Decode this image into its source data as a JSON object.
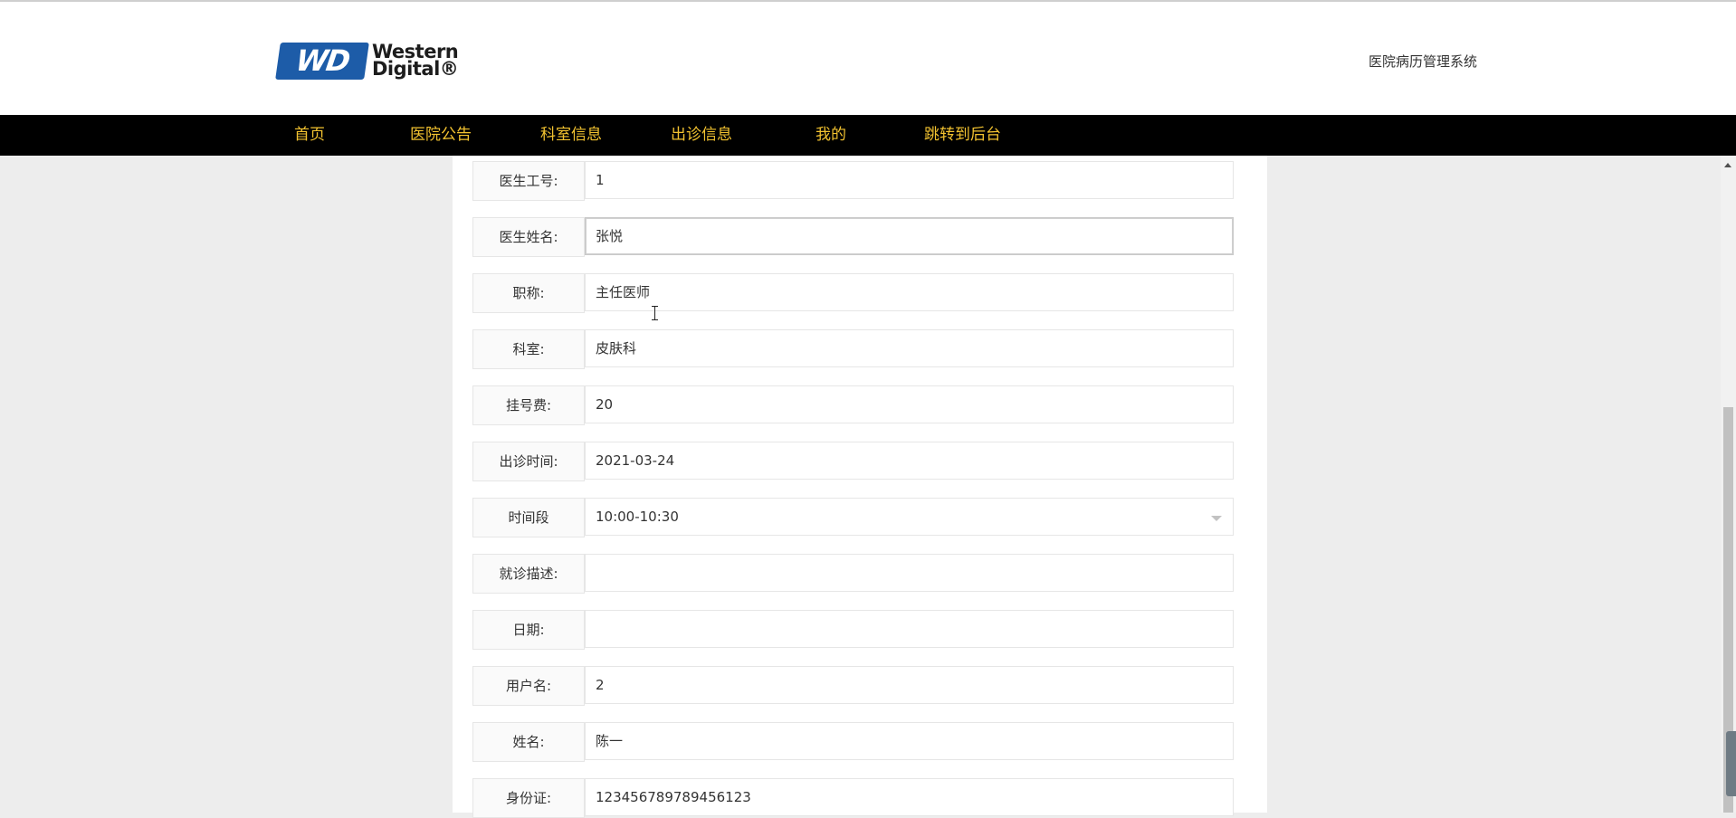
{
  "header": {
    "logo": {
      "badge": "WD",
      "line1": "Western",
      "line2": "Digital®"
    },
    "site_title": "医院病历管理系统"
  },
  "nav": {
    "items": [
      "首页",
      "医院公告",
      "科室信息",
      "出诊信息",
      "我的",
      "跳转到后台"
    ]
  },
  "form": {
    "fields": [
      {
        "label": "医生工号:",
        "value": "1"
      },
      {
        "label": "医生姓名:",
        "value": "张悦"
      },
      {
        "label": "职称:",
        "value": "主任医师"
      },
      {
        "label": "科室:",
        "value": "皮肤科"
      },
      {
        "label": "挂号费:",
        "value": "20"
      },
      {
        "label": "出诊时间:",
        "value": "2021-03-24"
      },
      {
        "label": "时间段",
        "value": "10:00-10:30"
      },
      {
        "label": "就诊描述:",
        "value": ""
      },
      {
        "label": "日期:",
        "value": ""
      },
      {
        "label": "用户名:",
        "value": "2"
      },
      {
        "label": "姓名:",
        "value": "陈一"
      },
      {
        "label": "身份证:",
        "value": "123456789789456123"
      }
    ]
  },
  "icons": {
    "select_arrow": "chevron-down-icon",
    "scroll_up": "arrow-up-icon",
    "text_cursor": "text-cursor-icon"
  },
  "colors": {
    "nav_background": "#000000",
    "nav_text": "#f2c230",
    "logo_blue": "#1d5ca8",
    "page_background": "#ededed"
  }
}
